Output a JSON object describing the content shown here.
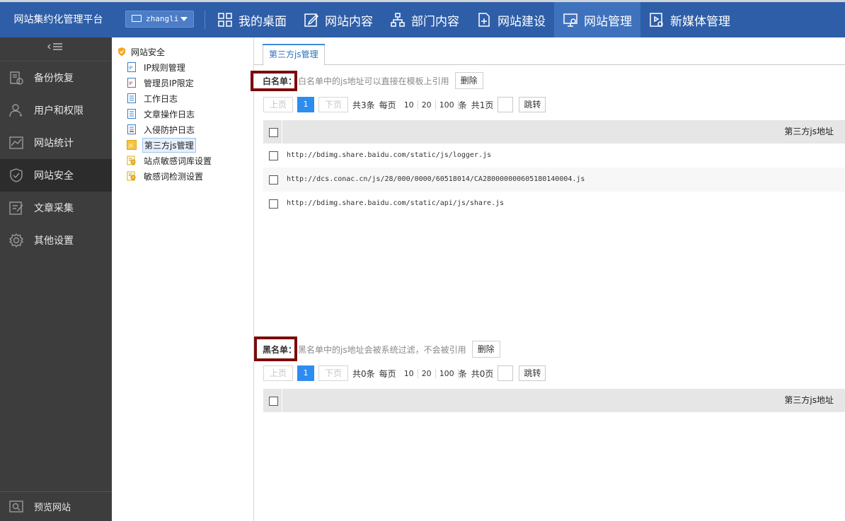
{
  "app": {
    "title": "网站集约化管理平台",
    "user": "zhangli"
  },
  "nav": [
    {
      "label": "我的桌面",
      "icon": "grid-icon",
      "active": false
    },
    {
      "label": "网站内容",
      "icon": "edit-icon",
      "active": false
    },
    {
      "label": "部门内容",
      "icon": "org-chart-icon",
      "active": false
    },
    {
      "label": "网站建设",
      "icon": "add-page-icon",
      "active": false
    },
    {
      "label": "网站管理",
      "icon": "monitor-gear-icon",
      "active": true
    },
    {
      "label": "新媒体管理",
      "icon": "media-settings-icon",
      "active": false
    }
  ],
  "sidebar": {
    "collapse_icon": "collapse-menu-icon",
    "items": [
      {
        "label": "备份恢复",
        "icon": "backup-icon",
        "active": false
      },
      {
        "label": "用户和权限",
        "icon": "user-icon",
        "active": false
      },
      {
        "label": "网站统计",
        "icon": "stats-icon",
        "active": false
      },
      {
        "label": "网站安全",
        "icon": "shield-icon",
        "active": true
      },
      {
        "label": "文章采集",
        "icon": "collect-icon",
        "active": false
      },
      {
        "label": "其他设置",
        "icon": "settings-icon",
        "active": false
      }
    ],
    "preview_label": "预览网站"
  },
  "tree": {
    "root": "网站安全",
    "children": [
      {
        "label": "IP规则管理",
        "icon": "ip-doc-icon",
        "selected": false
      },
      {
        "label": "管理员IP限定",
        "icon": "ip-doc-red-icon",
        "selected": false
      },
      {
        "label": "工作日志",
        "icon": "log-doc-icon",
        "selected": false
      },
      {
        "label": "文章操作日志",
        "icon": "log-doc-icon",
        "selected": false
      },
      {
        "label": "入侵防护日志",
        "icon": "log-doc-red-icon",
        "selected": false
      },
      {
        "label": "第三方js管理",
        "icon": "js-icon",
        "selected": true
      },
      {
        "label": "站点敏感词库设置",
        "icon": "sensitive-word-icon",
        "selected": false
      },
      {
        "label": "敏感词检测设置",
        "icon": "sensitive-word-icon",
        "selected": false
      }
    ]
  },
  "main": {
    "tab": "第三方js管理",
    "whitelist": {
      "label": "白名单：",
      "desc": "白名单中的js地址可以直接在模板上引用",
      "delete": "删除",
      "pager": {
        "prev": "上页",
        "page": "1",
        "next": "下页",
        "total": "共3条",
        "per_page": "每页",
        "sizes": [
          "10",
          "20",
          "100"
        ],
        "unit": "条",
        "pages": "共1页",
        "jump": "跳转"
      },
      "column": "第三方js地址",
      "rows": [
        "http://bdimg.share.baidu.com/static/js/logger.js",
        "http://dcs.conac.cn/js/28/000/0000/60518014/CA280000000605180140004.js",
        "http://bdimg.share.baidu.com/static/api/js/share.js"
      ]
    },
    "blacklist": {
      "label": "黑名单：",
      "desc": "黑名单中的js地址会被系统过滤，不会被引用",
      "delete": "删除",
      "pager": {
        "prev": "上页",
        "page": "1",
        "next": "下页",
        "total": "共0条",
        "per_page": "每页",
        "sizes": [
          "10",
          "20",
          "100"
        ],
        "unit": "条",
        "pages": "共0页",
        "jump": "跳转"
      },
      "column": "第三方js地址",
      "rows": []
    }
  },
  "colors": {
    "topbar": "#2e5ea8",
    "active_nav": "#3f72bd",
    "sidebar": "#3d3d3d",
    "highlight_box": "#7b0a0a",
    "page_active": "#2d8cf0"
  }
}
